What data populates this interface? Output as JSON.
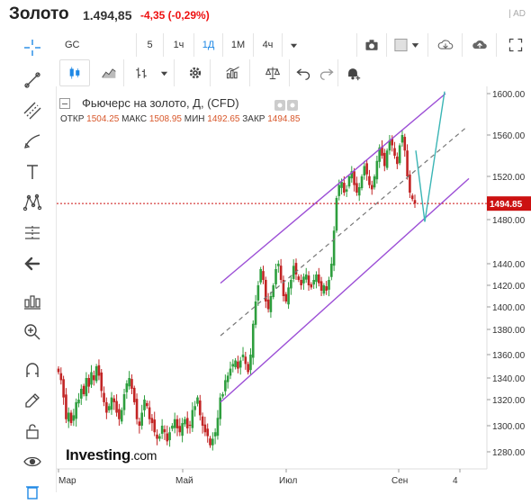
{
  "header": {
    "title": "Золото",
    "price": "1.494,85",
    "change": "-4,35 (-0,29%)",
    "ad": "| AD"
  },
  "toolbar": {
    "symbol": "GC",
    "intervals": [
      "5",
      "1ч",
      "1Д",
      "1М",
      "4ч"
    ],
    "active_interval": "1Д"
  },
  "legend": {
    "title": "Фьючерс на золото, Д, (CFD)",
    "ohlc": [
      {
        "label": "ОТКР",
        "value": "1504.25"
      },
      {
        "label": "МАКС",
        "value": "1508.95"
      },
      {
        "label": "МИН",
        "value": "1492.65"
      },
      {
        "label": "ЗАКР",
        "value": "1494.85"
      }
    ]
  },
  "logo": {
    "name": "Investing",
    "suffix": ".com"
  },
  "colors": {
    "up": "#2e9e3e",
    "down": "#c22424",
    "channel": "#9c4fd6",
    "midline": "#777777",
    "projection": "#3ab5b5",
    "price_line": "#cc1111"
  },
  "chart_data": {
    "type": "candlestick",
    "title": "Фьючерс на золото, Д, (CFD)",
    "last_price": 1494.85,
    "y_ticks": [
      1280,
      1300,
      1320,
      1340,
      1360,
      1380,
      1400,
      1420,
      1440,
      1480,
      1520,
      1560,
      1600
    ],
    "x_tick_labels": [
      "Мар",
      "Май",
      "Июл",
      "Сен",
      "4"
    ],
    "ylim": [
      1270,
      1605
    ],
    "candles_close": [
      1345,
      1338,
      1322,
      1305,
      1310,
      1302,
      1308,
      1318,
      1320,
      1330,
      1325,
      1340,
      1332,
      1345,
      1338,
      1350,
      1342,
      1328,
      1318,
      1310,
      1315,
      1322,
      1318,
      1310,
      1305,
      1312,
      1325,
      1335,
      1340,
      1330,
      1318,
      1305,
      1300,
      1310,
      1320,
      1315,
      1305,
      1302,
      1295,
      1290,
      1292,
      1300,
      1295,
      1288,
      1295,
      1300,
      1305,
      1298,
      1295,
      1302,
      1305,
      1298,
      1300,
      1312,
      1315,
      1322,
      1308,
      1300,
      1295,
      1292,
      1285,
      1290,
      1295,
      1306,
      1322,
      1325,
      1338,
      1342,
      1348,
      1352,
      1355,
      1348,
      1355,
      1360,
      1352,
      1345,
      1360,
      1385,
      1405,
      1420,
      1435,
      1425,
      1405,
      1398,
      1410,
      1420,
      1435,
      1440,
      1425,
      1410,
      1405,
      1418,
      1425,
      1438,
      1430,
      1425,
      1420,
      1428,
      1430,
      1420,
      1418,
      1425,
      1430,
      1422,
      1415,
      1420,
      1415,
      1425,
      1440,
      1470,
      1500,
      1512,
      1515,
      1505,
      1508,
      1520,
      1525,
      1512,
      1505,
      1510,
      1520,
      1530,
      1522,
      1512,
      1508,
      1520,
      1535,
      1548,
      1540,
      1530,
      1545,
      1555,
      1550,
      1540,
      1532,
      1550,
      1560,
      1545,
      1520,
      1505,
      1499,
      1494.85
    ],
    "channel_upper": [
      [
        1440,
        1410
      ],
      [
        1600,
        1600
      ]
    ],
    "channel_mid": [
      [
        1395,
        1340
      ],
      [
        1570,
        1580
      ]
    ],
    "channel_lower": [
      [
        1330,
        1310
      ],
      [
        1480,
        1515
      ]
    ],
    "projection": [
      [
        1545,
        1478,
        1602
      ]
    ]
  }
}
